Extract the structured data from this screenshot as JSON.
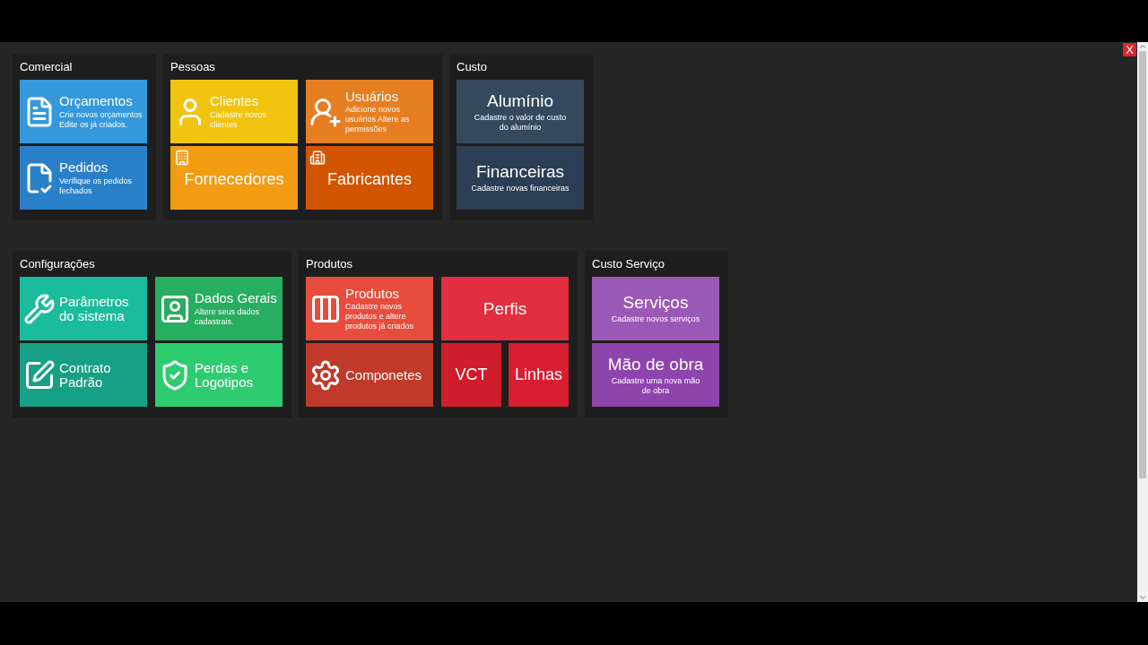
{
  "close_button": "X",
  "rows": [
    {
      "groups": [
        {
          "title": "Comercial",
          "tiles": [
            {
              "kind": "icon",
              "title": "Orçamentos",
              "subtitle": "Crie novos orçamentos Edite os já criados.",
              "color": "#3498db"
            },
            {
              "kind": "icon",
              "title": "Pedidos",
              "subtitle": "Verifique os pedidos fechados",
              "color": "#2980c9"
            }
          ]
        },
        {
          "title": "Pessoas",
          "tiles": [
            {
              "kind": "icon",
              "title": "Clientes",
              "subtitle": "Cadastre novos clientes",
              "color": "#f1c40f"
            },
            {
              "kind": "icon",
              "title": "Usuários",
              "subtitle": "Adicione novos usuários Altere as permissões",
              "color": "#e67e22"
            },
            {
              "kind": "banner",
              "title": "Fornecedores",
              "color": "#f39c12"
            },
            {
              "kind": "banner",
              "title": "Fabricantes",
              "color": "#d35400"
            }
          ]
        },
        {
          "title": "Custo",
          "tiles": [
            {
              "kind": "plain",
              "title": "Alumínio",
              "subtitle": "Cadastre o valor de custo do alumínio",
              "color": "#34495e"
            },
            {
              "kind": "plain",
              "title": "Financeiras",
              "subtitle": "Cadastre novas financeiras",
              "color": "#2c3e55"
            }
          ]
        }
      ]
    },
    {
      "groups": [
        {
          "title": "Configurações",
          "tiles": [
            {
              "kind": "icon",
              "title": "Parâmetros do sistema",
              "color": "#1abc9c"
            },
            {
              "kind": "icon",
              "title": "Dados Gerais",
              "subtitle": "Altere seus dados cadastrais.",
              "color": "#27ae60"
            },
            {
              "kind": "icon",
              "title": "Contrato Padrão",
              "color": "#16a085"
            },
            {
              "kind": "icon",
              "title": "Perdas e Logotipos",
              "color": "#2ecc71"
            }
          ]
        },
        {
          "title": "Produtos",
          "tiles": [
            {
              "kind": "icon",
              "title": "Produtos",
              "subtitle": "Cadastre novos produtos e altere produtos já criados",
              "color": "#e74c3c"
            },
            {
              "kind": "plain",
              "title": "Perfis",
              "color": "#e32d40"
            },
            {
              "kind": "icon",
              "title": "Componetes",
              "color": "#c0392b"
            },
            {
              "kind": "split",
              "tiles": [
                {
                  "title": "VCT",
                  "color": "#d01c2b"
                },
                {
                  "title": "Linhas",
                  "color": "#d81e30"
                }
              ]
            }
          ]
        },
        {
          "title": "Custo Serviço",
          "tiles": [
            {
              "kind": "plain",
              "title": "Serviços",
              "subtitle": "Cadastre novos serviços",
              "color": "#9b59b6"
            },
            {
              "kind": "plain",
              "title": "Mão de obra",
              "subtitle": "Cadastre uma nova mão de obra",
              "color": "#8e44ad"
            }
          ]
        }
      ]
    }
  ]
}
